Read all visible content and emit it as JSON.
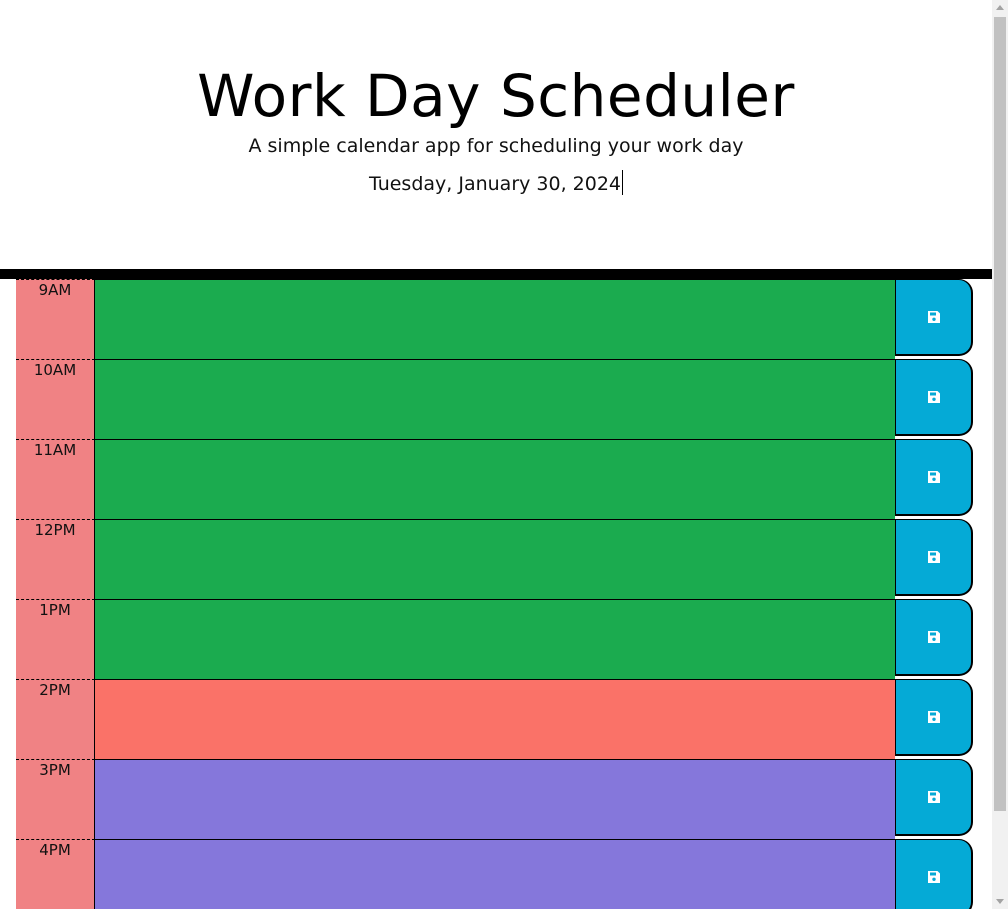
{
  "header": {
    "title": "Work Day Scheduler",
    "subtitle": "A simple calendar app for scheduling your work day",
    "current_date": "Tuesday, January 30, 2024"
  },
  "colors": {
    "hour_block": "#f08284",
    "past": "#1bab4f",
    "present": "#fa7268",
    "future": "#8577db",
    "save_button": "#05aad6"
  },
  "schedule": [
    {
      "hour": "9AM",
      "state": "past",
      "text": "",
      "save_icon": "floppy-disk-icon"
    },
    {
      "hour": "10AM",
      "state": "past",
      "text": "",
      "save_icon": "floppy-disk-icon"
    },
    {
      "hour": "11AM",
      "state": "past",
      "text": "",
      "save_icon": "floppy-disk-icon"
    },
    {
      "hour": "12PM",
      "state": "past",
      "text": "",
      "save_icon": "floppy-disk-icon"
    },
    {
      "hour": "1PM",
      "state": "past",
      "text": "",
      "save_icon": "floppy-disk-icon"
    },
    {
      "hour": "2PM",
      "state": "present",
      "text": "",
      "save_icon": "floppy-disk-icon"
    },
    {
      "hour": "3PM",
      "state": "future",
      "text": "",
      "save_icon": "floppy-disk-icon"
    },
    {
      "hour": "4PM",
      "state": "future",
      "text": "",
      "save_icon": "floppy-disk-icon"
    }
  ]
}
